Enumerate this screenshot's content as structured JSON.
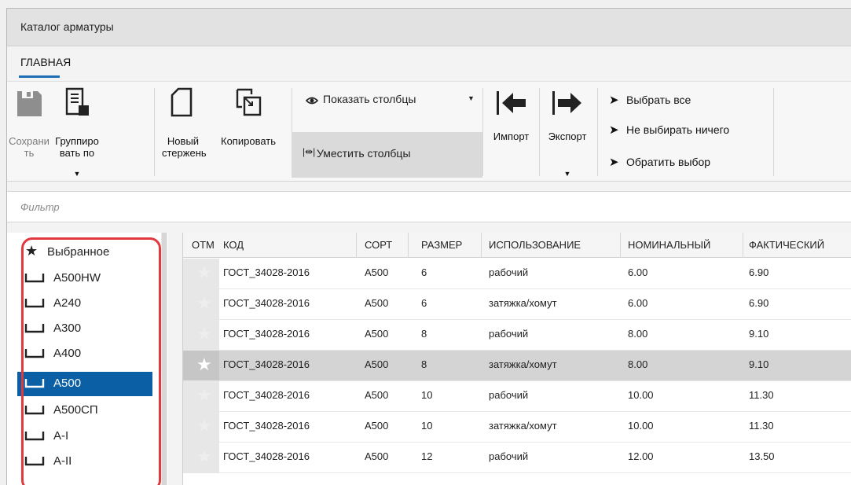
{
  "window": {
    "title": "Каталог арматуры"
  },
  "ribbon": {
    "tab_home": "ГЛАВНАЯ",
    "save_label": "Сохранить",
    "group_by_label": "Группировать по",
    "new_bar_label": "Новый стержень",
    "copy_label": "Копировать",
    "show_columns_label": "Показать столбцы",
    "fit_columns_label": "Уместить столбцы",
    "import_label": "Импорт",
    "export_label": "Экспорт",
    "select_all_label": "Выбрать все",
    "select_none_label": "Не выбирать ничего",
    "invert_selection_label": "Обратить выбор"
  },
  "filter": {
    "placeholder": "Фильтр"
  },
  "sidebar": {
    "items": [
      {
        "label": "Выбранное",
        "icon": "star-icon"
      },
      {
        "label": "A500HW",
        "icon": "bar-shape-icon"
      },
      {
        "label": "A240",
        "icon": "bar-shape-icon"
      },
      {
        "label": "A300",
        "icon": "bar-shape-icon"
      },
      {
        "label": "A400",
        "icon": "bar-shape-icon"
      },
      {
        "label": "A500",
        "icon": "bar-shape-icon",
        "selected": true
      },
      {
        "label": "A500СП",
        "icon": "bar-shape-icon"
      },
      {
        "label": "A-I",
        "icon": "bar-shape-icon"
      },
      {
        "label": "A-II",
        "icon": "bar-shape-icon"
      }
    ]
  },
  "table": {
    "columns": [
      "ОТМ",
      "КОД",
      "СОРТ",
      "РАЗМЕР",
      "ИСПОЛЬЗОВАНИЕ",
      "НОМИНАЛЬНЫЙ",
      "ФАКТИЧЕСКИЙ"
    ],
    "rows": [
      {
        "code": "ГОСТ_34028-2016",
        "grade": "A500",
        "size": "6",
        "usage": "рабочий",
        "nominal": "6.00",
        "actual": "6.90"
      },
      {
        "code": "ГОСТ_34028-2016",
        "grade": "A500",
        "size": "6",
        "usage": "затяжка/хомут",
        "nominal": "6.00",
        "actual": "6.90"
      },
      {
        "code": "ГОСТ_34028-2016",
        "grade": "A500",
        "size": "8",
        "usage": "рабочий",
        "nominal": "8.00",
        "actual": "9.10"
      },
      {
        "code": "ГОСТ_34028-2016",
        "grade": "A500",
        "size": "8",
        "usage": "затяжка/хомут",
        "nominal": "8.00",
        "actual": "9.10",
        "selected": true
      },
      {
        "code": "ГОСТ_34028-2016",
        "grade": "A500",
        "size": "10",
        "usage": "рабочий",
        "nominal": "10.00",
        "actual": "11.30"
      },
      {
        "code": "ГОСТ_34028-2016",
        "grade": "A500",
        "size": "10",
        "usage": "затяжка/хомут",
        "nominal": "10.00",
        "actual": "11.30"
      },
      {
        "code": "ГОСТ_34028-2016",
        "grade": "A500",
        "size": "12",
        "usage": "рабочий",
        "nominal": "12.00",
        "actual": "13.50"
      }
    ]
  },
  "colors": {
    "accent": "#0b5fa5",
    "highlight_border": "#e0393e",
    "selected_row": "#d4d4d4"
  }
}
